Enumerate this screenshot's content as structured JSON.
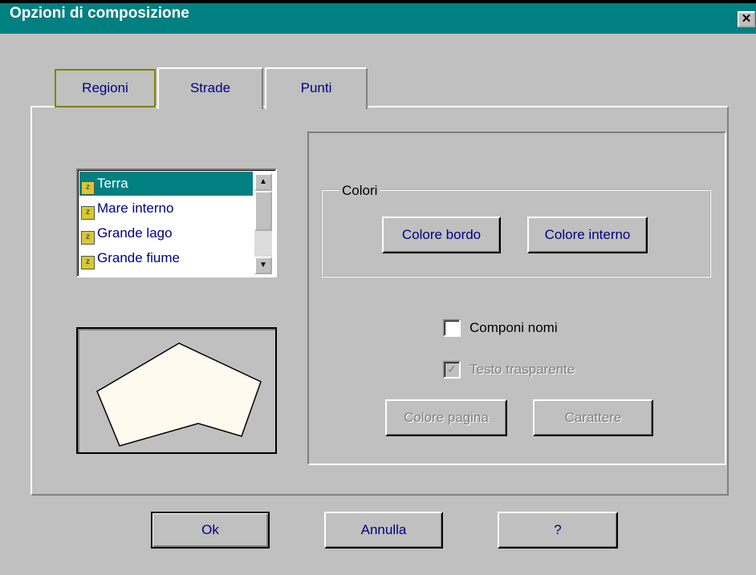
{
  "window": {
    "title": "Opzioni di composizione",
    "close_label": "✕"
  },
  "tabs": [
    {
      "label": "Regioni",
      "active": true
    },
    {
      "label": "Strade",
      "active": false
    },
    {
      "label": "Punti",
      "active": false
    }
  ],
  "region_list": {
    "items": [
      {
        "label": "Terra",
        "selected": true,
        "icon": "region-icon"
      },
      {
        "label": "Mare interno",
        "selected": false,
        "icon": "region-icon"
      },
      {
        "label": "Grande lago",
        "selected": false,
        "icon": "region-icon"
      },
      {
        "label": "Grande fiume",
        "selected": false,
        "icon": "region-icon"
      }
    ]
  },
  "preview": {
    "fill_color": "#fffaf0",
    "stroke_color": "#000000"
  },
  "colors_group": {
    "label": "Colori",
    "border_button": "Colore bordo",
    "fill_button": "Colore interno"
  },
  "options": {
    "compose_names": {
      "label": "Componi nomi",
      "checked": false,
      "enabled": true
    },
    "transparent_text": {
      "label": "Testo trasparente",
      "checked": true,
      "enabled": false
    },
    "page_color_button": "Colore pagina",
    "font_button": "Carattere"
  },
  "footer": {
    "ok_label": "Ok",
    "cancel_label": "Annulla",
    "help_label": "?"
  },
  "colors": {
    "titlebar": "#008080",
    "face": "#c0c0c0",
    "selection": "#008080",
    "link_text": "#000080"
  }
}
